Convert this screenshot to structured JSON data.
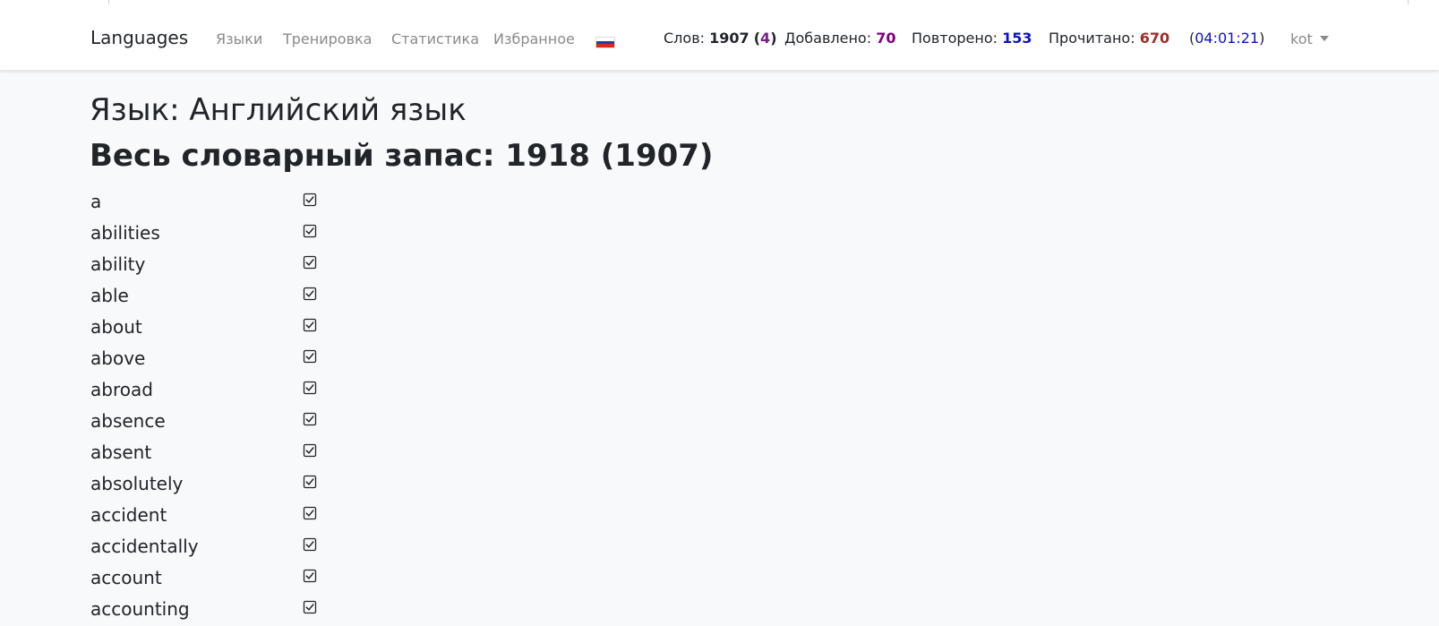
{
  "navbar": {
    "brand": "Languages",
    "links": [
      "Языки",
      "Тренировка",
      "Статистика",
      "Избранное"
    ],
    "flag_icon": "russia-flag-icon",
    "flag_colors": [
      "#ffffff",
      "#1c3fa8",
      "#d52b1e"
    ],
    "stats": {
      "words_label": "Слов:",
      "words_value": "1907",
      "words_extra_open": "(",
      "words_extra": "4",
      "words_extra_close": ")",
      "added_label": "Добавлено:",
      "added_value": "70",
      "repeated_label": "Повторено:",
      "repeated_value": "153",
      "read_label": "Прочитано:",
      "read_value": "670",
      "time_open": "(",
      "time_value": "04:01:21",
      "time_close": ")"
    },
    "stat_colors": {
      "words_extra": "#7a1f8a",
      "added": "#800080",
      "repeated": "#1010c8",
      "read": "#a52a2a",
      "time": "#1010c8"
    },
    "user": "kot"
  },
  "main": {
    "language_heading": "Язык: Английский язык",
    "vocabulary_heading": "Весь словарный запас: 1918 (1907)",
    "words": [
      "a",
      "abilities",
      "ability",
      "able",
      "about",
      "above",
      "abroad",
      "absence",
      "absent",
      "absolutely",
      "accident",
      "accidentally",
      "account",
      "accounting"
    ],
    "check_icon": "checked-box-icon"
  }
}
